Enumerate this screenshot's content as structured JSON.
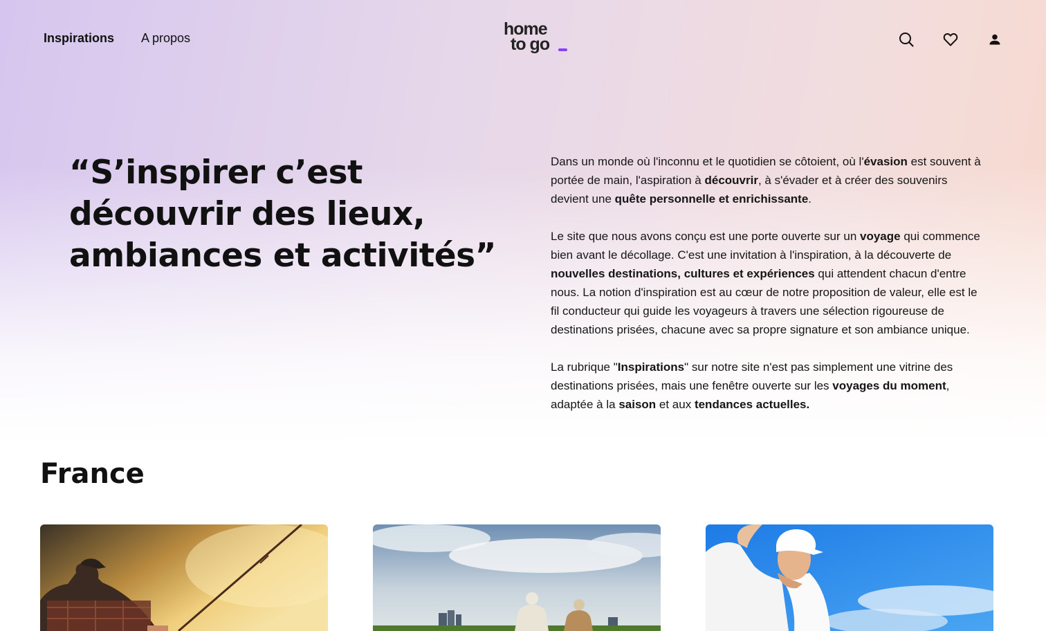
{
  "header": {
    "nav": [
      {
        "label": "Inspirations",
        "active": true
      },
      {
        "label": "A propos",
        "active": false
      }
    ],
    "logo": {
      "line1": "home",
      "line2": "to go"
    },
    "icons": [
      "search-icon",
      "heart-icon",
      "user-icon"
    ]
  },
  "hero": {
    "quote_lines": [
      "“S’inspirer c’est",
      "découvrir des lieux,",
      "ambiances et activités”"
    ],
    "paragraphs": [
      [
        {
          "t": "Dans un monde où l'inconnu et le quotidien se côtoient, où l'"
        },
        {
          "t": "évasion",
          "b": true
        },
        {
          "t": " est souvent à portée de main, l'aspiration à "
        },
        {
          "t": "découvrir",
          "b": true
        },
        {
          "t": ", à s'évader et à créer des souvenirs devient une "
        },
        {
          "t": "quête personnelle et enrichissante",
          "b": true
        },
        {
          "t": "."
        }
      ],
      [
        {
          "t": "Le site que nous avons conçu est une porte ouverte sur un "
        },
        {
          "t": "voyage",
          "b": true
        },
        {
          "t": " qui commence bien avant le décollage. C'est une invitation à l'inspiration, à la découverte de "
        },
        {
          "t": "nouvelles destinations, cultures et expériences",
          "b": true
        },
        {
          "t": " qui attendent chacun d'entre nous. La notion d'inspiration est au cœur de notre proposition de valeur, elle est le fil conducteur qui guide les voyageurs à travers une sélection rigoureuse de destinations prisées, chacune avec sa propre signature et son ambiance unique."
        }
      ],
      [
        {
          "t": "La rubrique \""
        },
        {
          "t": "Inspirations",
          "b": true
        },
        {
          "t": "\" sur notre site n'est pas simplement une vitrine des destinations prisées, mais une fenêtre ouverte sur les "
        },
        {
          "t": "voyages du moment",
          "b": true
        },
        {
          "t": ", adaptée à la "
        },
        {
          "t": "saison",
          "b": true
        },
        {
          "t": " et aux "
        },
        {
          "t": "tendances actuelles.",
          "b": true
        }
      ]
    ]
  },
  "section": {
    "title": "France",
    "cards": [
      {
        "image": "fisherman-sunset-photo"
      },
      {
        "image": "seniors-field-city-photo"
      },
      {
        "image": "golfer-blue-sky-photo"
      }
    ]
  },
  "colors": {
    "accent": "#8a3ffc",
    "gradient_left": "#d6c6ef",
    "gradient_right": "#f8d9cc"
  }
}
